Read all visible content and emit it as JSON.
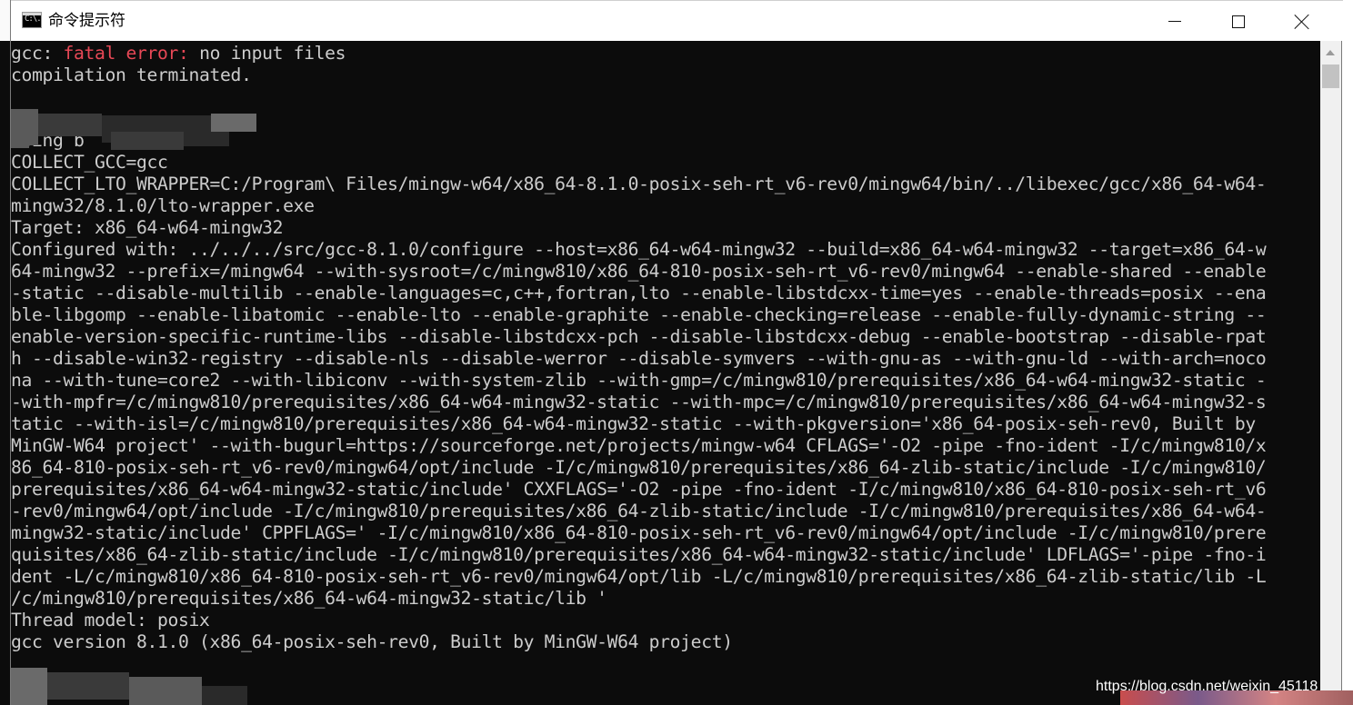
{
  "window": {
    "title": "命令提示符",
    "icon_label": "C:\\.",
    "buttons": {
      "minimize": "minimize-icon",
      "maximize": "maximize-icon",
      "close": "close-icon"
    }
  },
  "console": {
    "lines": [
      {
        "prefix": "gcc: ",
        "error": "fatal error:",
        "suffix": " no input files"
      },
      {
        "text": "compilation terminated."
      },
      {
        "text": ""
      },
      {
        "text": ""
      },
      {
        "text": "Using b"
      },
      {
        "text": "COLLECT_GCC=gcc"
      },
      {
        "text": "COLLECT_LTO_WRAPPER=C:/Program\\ Files/mingw-w64/x86_64-8.1.0-posix-seh-rt_v6-rev0/mingw64/bin/../libexec/gcc/x86_64-w64-"
      },
      {
        "text": "mingw32/8.1.0/lto-wrapper.exe"
      },
      {
        "text": "Target: x86_64-w64-mingw32"
      },
      {
        "text": "Configured with: ../../../src/gcc-8.1.0/configure --host=x86_64-w64-mingw32 --build=x86_64-w64-mingw32 --target=x86_64-w"
      },
      {
        "text": "64-mingw32 --prefix=/mingw64 --with-sysroot=/c/mingw810/x86_64-810-posix-seh-rt_v6-rev0/mingw64 --enable-shared --enable"
      },
      {
        "text": "-static --disable-multilib --enable-languages=c,c++,fortran,lto --enable-libstdcxx-time=yes --enable-threads=posix --ena"
      },
      {
        "text": "ble-libgomp --enable-libatomic --enable-lto --enable-graphite --enable-checking=release --enable-fully-dynamic-string --"
      },
      {
        "text": "enable-version-specific-runtime-libs --disable-libstdcxx-pch --disable-libstdcxx-debug --enable-bootstrap --disable-rpat"
      },
      {
        "text": "h --disable-win32-registry --disable-nls --disable-werror --disable-symvers --with-gnu-as --with-gnu-ld --with-arch=noco"
      },
      {
        "text": "na --with-tune=core2 --with-libiconv --with-system-zlib --with-gmp=/c/mingw810/prerequisites/x86_64-w64-mingw32-static -"
      },
      {
        "text": "-with-mpfr=/c/mingw810/prerequisites/x86_64-w64-mingw32-static --with-mpc=/c/mingw810/prerequisites/x86_64-w64-mingw32-s"
      },
      {
        "text": "tatic --with-isl=/c/mingw810/prerequisites/x86_64-w64-mingw32-static --with-pkgversion='x86_64-posix-seh-rev0, Built by"
      },
      {
        "text": "MinGW-W64 project' --with-bugurl=https://sourceforge.net/projects/mingw-w64 CFLAGS='-O2 -pipe -fno-ident -I/c/mingw810/x"
      },
      {
        "text": "86_64-810-posix-seh-rt_v6-rev0/mingw64/opt/include -I/c/mingw810/prerequisites/x86_64-zlib-static/include -I/c/mingw810/"
      },
      {
        "text": "prerequisites/x86_64-w64-mingw32-static/include' CXXFLAGS='-O2 -pipe -fno-ident -I/c/mingw810/x86_64-810-posix-seh-rt_v6"
      },
      {
        "text": "-rev0/mingw64/opt/include -I/c/mingw810/prerequisites/x86_64-zlib-static/include -I/c/mingw810/prerequisites/x86_64-w64-"
      },
      {
        "text": "mingw32-static/include' CPPFLAGS=' -I/c/mingw810/x86_64-810-posix-seh-rt_v6-rev0/mingw64/opt/include -I/c/mingw810/prere"
      },
      {
        "text": "quisites/x86_64-zlib-static/include -I/c/mingw810/prerequisites/x86_64-w64-mingw32-static/include' LDFLAGS='-pipe -fno-i"
      },
      {
        "text": "dent -L/c/mingw810/x86_64-810-posix-seh-rt_v6-rev0/mingw64/opt/lib -L/c/mingw810/prerequisites/x86_64-zlib-static/lib -L"
      },
      {
        "text": "/c/mingw810/prerequisites/x86_64-w64-mingw32-static/lib '"
      },
      {
        "text": "Thread model: posix"
      },
      {
        "text": "gcc version 8.1.0 (x86_64-posix-seh-rev0, Built by MinGW-W64 project)"
      }
    ]
  },
  "colors": {
    "console_bg": "#0c0c0c",
    "console_fg": "#cccccc",
    "error_fg": "#e74856",
    "titlebar_bg": "#ffffff"
  },
  "watermark": "https://blog.csdn.net/weixin_45118"
}
